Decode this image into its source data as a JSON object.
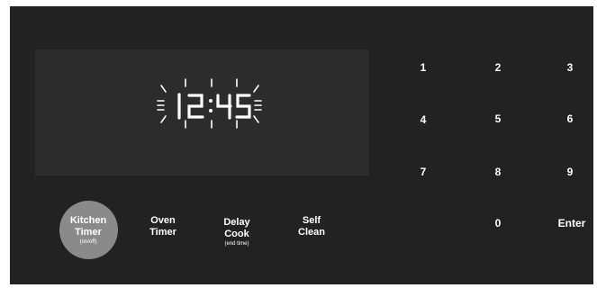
{
  "display": {
    "time": [
      "1",
      "2",
      ":",
      "4",
      "5"
    ],
    "state": "flashing"
  },
  "keypad": {
    "keys": [
      "1",
      "2",
      "3",
      "4",
      "5",
      "6",
      "7",
      "8",
      "9",
      "0",
      "Enter"
    ]
  },
  "functions": {
    "kitchen_timer": {
      "line1": "Kitchen",
      "line2": "Timer",
      "sub": "(on/off)",
      "active": true
    },
    "oven_timer": {
      "line1": "Oven",
      "line2": "Timer"
    },
    "delay_cook": {
      "line1": "Delay",
      "line2": "Cook",
      "sub": "(end time)"
    },
    "self_clean": {
      "line1": "Self",
      "line2": "Clean"
    }
  },
  "colors": {
    "panel": "#222222",
    "display": "#2c2c2c",
    "text": "#ffffff",
    "active_button": "#8a8a8a"
  }
}
